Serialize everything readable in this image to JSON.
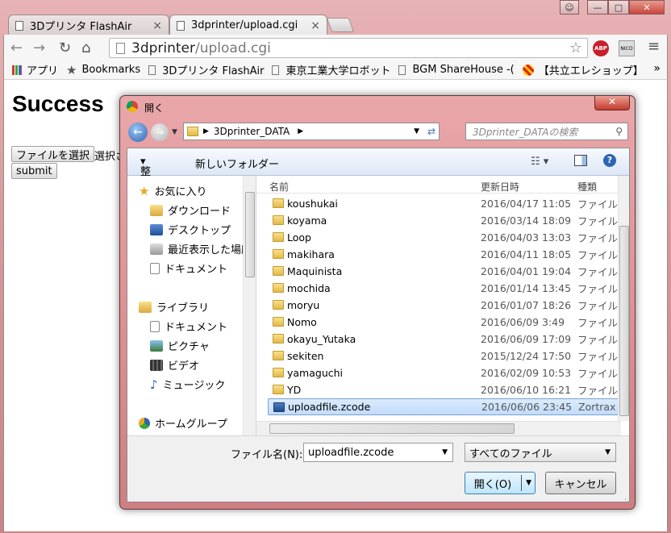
{
  "browser": {
    "tabs": [
      {
        "label": "3Dプリンタ FlashAir"
      },
      {
        "label": "3dprinter/upload.cgi"
      }
    ],
    "url_host": "3dprinter",
    "url_path": "/upload.cgi",
    "bookmarks": [
      "アプリ",
      "Bookmarks",
      "3Dプリンタ FlashAir",
      "東京工業大学ロボット",
      "BGM ShareHouse -(",
      "【共立エレショップ】"
    ],
    "ext_abp": "ABP",
    "ext_nico": "NICO"
  },
  "page": {
    "heading": "Success",
    "choose_file_label": "ファイルを選択",
    "no_file_text": "選択さ",
    "submit_label": "submit"
  },
  "dialog": {
    "title": "開く",
    "breadcrumb": "3Dprinter_DATA",
    "search_placeholder": "3Dprinter_DATAの検索",
    "organize_label": "整理",
    "new_folder_label": "新しいフォルダー",
    "nav_items": [
      "お気に入り",
      "ダウンロード",
      "デスクトップ",
      "最近表示した場所",
      "ドキュメント",
      "ライブラリ",
      "ドキュメント",
      "ピクチャ",
      "ビデオ",
      "ミュージック",
      "ホームグループ"
    ],
    "columns": [
      "名前",
      "更新日時",
      "種類"
    ],
    "files": [
      {
        "name": "koushukai",
        "date": "2016/04/17 11:05",
        "type": "ファイル"
      },
      {
        "name": "koyama",
        "date": "2016/03/14 18:09",
        "type": "ファイル"
      },
      {
        "name": "Loop",
        "date": "2016/04/03 13:03",
        "type": "ファイル"
      },
      {
        "name": "makihara",
        "date": "2016/04/11 18:05",
        "type": "ファイル"
      },
      {
        "name": "Maquinista",
        "date": "2016/04/01 19:04",
        "type": "ファイル"
      },
      {
        "name": "mochida",
        "date": "2016/01/14 13:45",
        "type": "ファイル"
      },
      {
        "name": "moryu",
        "date": "2016/01/07 18:26",
        "type": "ファイル"
      },
      {
        "name": "Nomo",
        "date": "2016/06/09 3:49",
        "type": "ファイル"
      },
      {
        "name": "okayu_Yutaka",
        "date": "2016/06/09 17:09",
        "type": "ファイル"
      },
      {
        "name": "sekiten",
        "date": "2015/12/24 17:50",
        "type": "ファイル"
      },
      {
        "name": "yamaguchi",
        "date": "2016/02/09 10:53",
        "type": "ファイル"
      },
      {
        "name": "YD",
        "date": "2016/06/10 16:21",
        "type": "ファイル"
      },
      {
        "name": "uploadfile.zcode",
        "date": "2016/06/06 23:45",
        "type": "Zortrax"
      }
    ],
    "filename_label": "ファイル名(N):",
    "filename_value": "uploadfile.zcode",
    "filter_value": "すべてのファイル",
    "open_label": "開く(O)",
    "cancel_label": "キャンセル"
  }
}
